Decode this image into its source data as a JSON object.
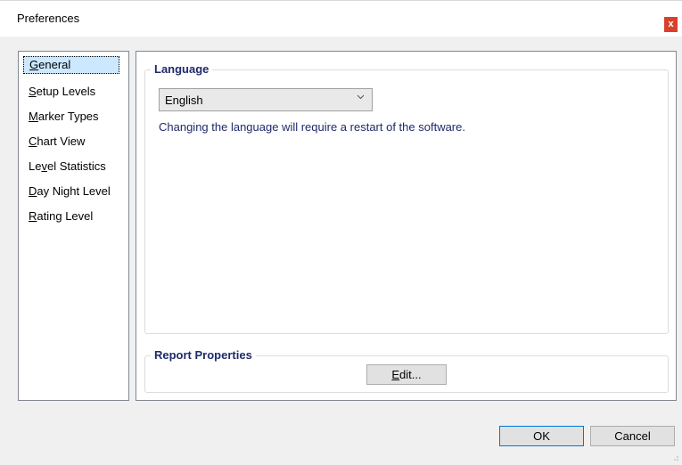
{
  "window": {
    "title": "Preferences",
    "close_label": "x"
  },
  "sidebar": {
    "items": [
      {
        "label": "General",
        "mnemonic": "G",
        "rest": "eneral",
        "selected": true
      },
      {
        "label": "Setup Levels",
        "mnemonic": "S",
        "rest": "etup Levels"
      },
      {
        "label": "Marker Types",
        "mnemonic": "M",
        "rest": "arker Types"
      },
      {
        "label": "Chart View",
        "mnemonic": "C",
        "rest": "hart View"
      },
      {
        "label": "Level Statistics",
        "pre": "Le",
        "mnemonic": "v",
        "rest": "el Statistics"
      },
      {
        "label": "Day Night Level",
        "mnemonic": "D",
        "rest": "ay Night Level"
      },
      {
        "label": "Rating Level",
        "mnemonic": "R",
        "rest": "ating Level"
      }
    ]
  },
  "language": {
    "group_label": "Language",
    "selected": "English",
    "note": "Changing the language will require a restart of the software."
  },
  "report": {
    "group_label": "Report Properties",
    "edit_mnemonic": "E",
    "edit_rest": "dit..."
  },
  "footer": {
    "ok_label": "OK",
    "cancel_label": "Cancel"
  },
  "colors": {
    "selection": "#cce8ff",
    "group_label": "#1f2a6b",
    "close": "#d9402c"
  },
  "icons": {
    "dropdown": "chevron-down-icon",
    "close": "close-icon",
    "grip": "resize-grip-icon"
  }
}
